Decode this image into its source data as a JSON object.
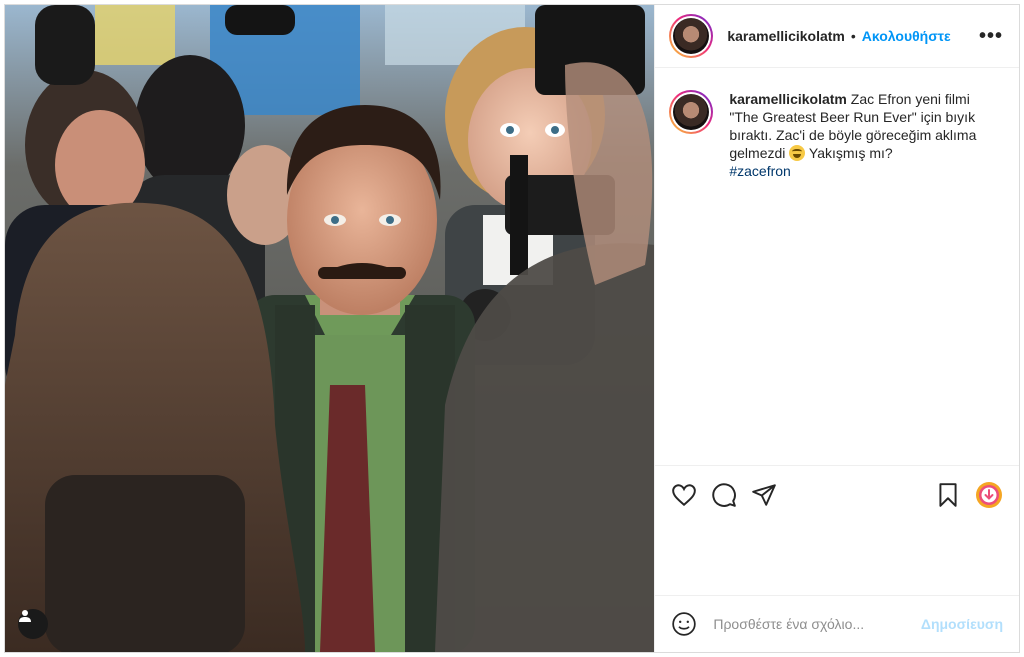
{
  "post": {
    "username": "karamellicikolatm",
    "separator": "•",
    "follow_label": "Ακολουθήστε",
    "more_label": "•••"
  },
  "caption": {
    "username": "karamellicikolatm",
    "text_part1": " Zac Efron yeni filmi \"The Greatest Beer Run Ever\" için bıyık bıraktı. Zac'i de böyle göreceğim aklıma gelmezdi ",
    "emoji": "grinning-sweat-emoji",
    "text_part2": " Yakışmış mı?",
    "hashtag": "#zacefron"
  },
  "comment": {
    "placeholder": "Προσθέστε ένα σχόλιο...",
    "post_label": "Δημοσίευση"
  },
  "colors": {
    "link_blue": "#0095f6",
    "hashtag": "#00376b",
    "post_disabled": "#b2dffc"
  },
  "icons": [
    "user-tag-icon",
    "heart-icon",
    "comment-icon",
    "share-icon",
    "bookmark-icon",
    "download-icon",
    "emoji-icon",
    "more-options-icon"
  ]
}
